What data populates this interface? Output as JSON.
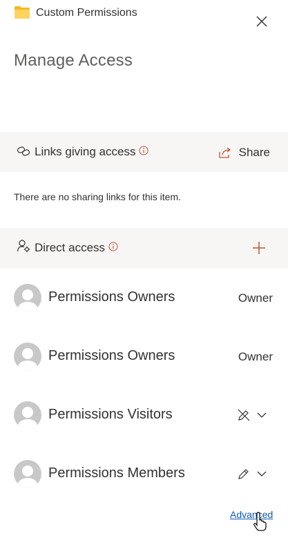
{
  "header": {
    "item_name": "Custom Permissions",
    "title": "Manage Access",
    "folder_color": "#f8c94a"
  },
  "links": {
    "label": "Links giving access",
    "share_label": "Share",
    "empty_message": "There are no sharing links for this item."
  },
  "direct": {
    "label": "Direct access"
  },
  "members": [
    {
      "name": "Permissions Owners",
      "role": "Owner"
    },
    {
      "name": "Permissions Owners",
      "role": "Owner"
    },
    {
      "name": "Permissions Visitors",
      "role": ""
    },
    {
      "name": "Permissions Members",
      "role": ""
    }
  ],
  "footer": {
    "advanced_label": "Advanced"
  },
  "colors": {
    "accent": "#c4502f",
    "link": "#0a58b8",
    "section_bg": "#f7f6f5"
  }
}
